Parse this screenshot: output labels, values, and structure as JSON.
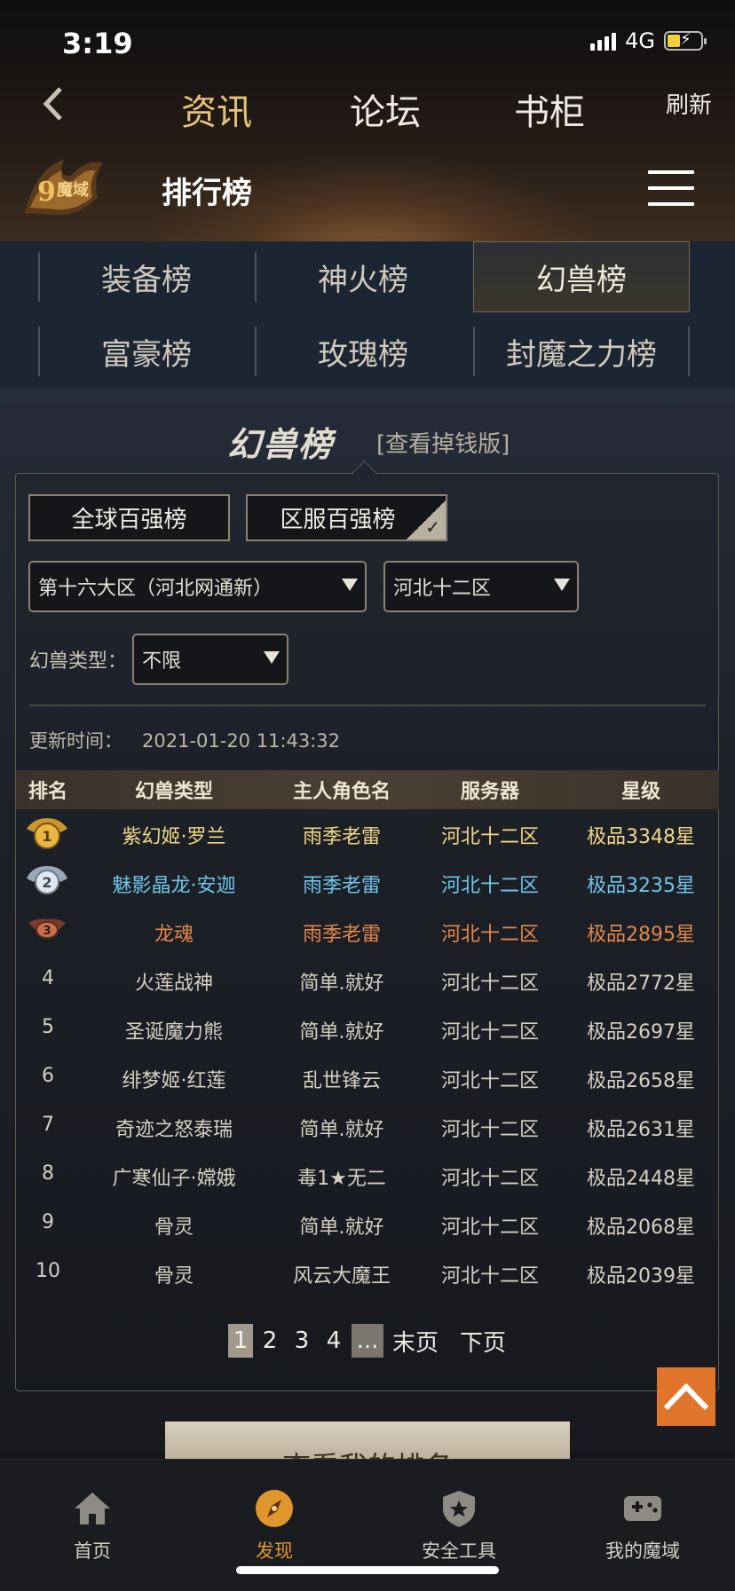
{
  "status": {
    "time": "3:19",
    "network": "4G"
  },
  "nav": {
    "tabs": [
      {
        "label": "资讯",
        "active": true
      },
      {
        "label": "论坛",
        "active": false
      },
      {
        "label": "书柜",
        "active": false
      }
    ],
    "refresh": "刷新"
  },
  "header": {
    "logo_icon": "game-logo",
    "title": "排行榜"
  },
  "categories": [
    {
      "label": "装备榜",
      "active": false
    },
    {
      "label": "神火榜",
      "active": false
    },
    {
      "label": "幻兽榜",
      "active": true
    },
    {
      "label": "富豪榜",
      "active": false
    },
    {
      "label": "玫瑰榜",
      "active": false
    },
    {
      "label": "封魔之力榜",
      "active": false
    }
  ],
  "ranking": {
    "title": "幻兽榜",
    "subtitle": "[查看掉钱版]",
    "scope_buttons": [
      {
        "label": "全球百强榜",
        "selected": false
      },
      {
        "label": "区服百强榜",
        "selected": true
      }
    ],
    "region_select": "第十六大区（河北网通新）",
    "server_select": "河北十二区",
    "beast_type_label": "幻兽类型：",
    "beast_type_select": "不限",
    "update_label": "更新时间：",
    "update_time": "2021-01-20 11:43:32"
  },
  "table": {
    "headers": [
      "排名",
      "幻兽类型",
      "主人角色名",
      "服务器",
      "星级"
    ],
    "rows": [
      {
        "rank": "1",
        "type": "紫幻姬·罗兰",
        "owner": "雨季老雷",
        "server": "河北十二区",
        "stars": "极品3348星"
      },
      {
        "rank": "2",
        "type": "魅影晶龙·安迦",
        "owner": "雨季老雷",
        "server": "河北十二区",
        "stars": "极品3235星"
      },
      {
        "rank": "3",
        "type": "龙魂",
        "owner": "雨季老雷",
        "server": "河北十二区",
        "stars": "极品2895星"
      },
      {
        "rank": "4",
        "type": "火莲战神",
        "owner": "简单.就好",
        "server": "河北十二区",
        "stars": "极品2772星"
      },
      {
        "rank": "5",
        "type": "圣诞魔力熊",
        "owner": "简单.就好",
        "server": "河北十二区",
        "stars": "极品2697星"
      },
      {
        "rank": "6",
        "type": "绯梦姬·红莲",
        "owner": "乱世锋云",
        "server": "河北十二区",
        "stars": "极品2658星"
      },
      {
        "rank": "7",
        "type": "奇迹之怒泰瑞",
        "owner": "简单.就好",
        "server": "河北十二区",
        "stars": "极品2631星"
      },
      {
        "rank": "8",
        "type": "广寒仙子·嫦娥",
        "owner": "毒1★无二",
        "server": "河北十二区",
        "stars": "极品2448星"
      },
      {
        "rank": "9",
        "type": "骨灵",
        "owner": "简单.就好",
        "server": "河北十二区",
        "stars": "极品2068星"
      },
      {
        "rank": "10",
        "type": "骨灵",
        "owner": "风云大魔王",
        "server": "河北十二区",
        "stars": "极品2039星"
      }
    ]
  },
  "pagination": {
    "pages": [
      "1",
      "2",
      "3",
      "4"
    ],
    "ellipsis": "...",
    "last": "末页",
    "next": "下页",
    "current": "1"
  },
  "my_rank_button": "查看我的排名",
  "bottom_nav": [
    {
      "label": "首页",
      "icon": "home-icon"
    },
    {
      "label": "发现",
      "icon": "compass-icon",
      "active": true
    },
    {
      "label": "安全工具",
      "icon": "shield-star-icon"
    },
    {
      "label": "我的魔域",
      "icon": "gamepad-icon"
    }
  ],
  "colors": {
    "gold": "#f0d888",
    "blue": "#6fc6ea",
    "bronze": "#e2884a",
    "accent": "#e0962c",
    "to_top": "#e0742a"
  }
}
